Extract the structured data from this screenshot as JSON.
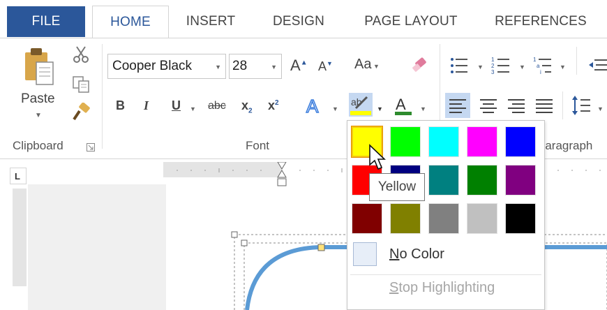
{
  "tabs": {
    "file": "FILE",
    "home": "HOME",
    "insert": "INSERT",
    "design": "DESIGN",
    "page_layout": "PAGE LAYOUT",
    "references": "REFERENCES"
  },
  "clipboard": {
    "paste_label": "Paste",
    "group_label": "Clipboard"
  },
  "font": {
    "font_name": "Cooper Black",
    "font_size": "28",
    "group_label": "Font",
    "change_case": "Aa",
    "bold": "B",
    "italic": "I",
    "underline": "U",
    "strikethrough": "abc",
    "subscript": "x",
    "superscript": "x"
  },
  "paragraph": {
    "group_label": "Paragraph"
  },
  "highlight_palette": {
    "swatches": [
      {
        "name": "Yellow",
        "color": "#ffff00"
      },
      {
        "name": "Bright Green",
        "color": "#00ff00"
      },
      {
        "name": "Turquoise",
        "color": "#00ffff"
      },
      {
        "name": "Pink",
        "color": "#ff00ff"
      },
      {
        "name": "Blue",
        "color": "#0000ff"
      },
      {
        "name": "Red",
        "color": "#ff0000"
      },
      {
        "name": "Dark Blue",
        "color": "#000080"
      },
      {
        "name": "Teal",
        "color": "#008080"
      },
      {
        "name": "Green",
        "color": "#008000"
      },
      {
        "name": "Violet",
        "color": "#800080"
      },
      {
        "name": "Dark Red",
        "color": "#800000"
      },
      {
        "name": "Dark Yellow",
        "color": "#808000"
      },
      {
        "name": "Gray 50%",
        "color": "#808080"
      },
      {
        "name": "Gray 25%",
        "color": "#c0c0c0"
      },
      {
        "name": "Black",
        "color": "#000000"
      }
    ],
    "no_color_underlined": "N",
    "no_color_rest": "o Color",
    "stop_underlined": "S",
    "stop_rest": "top Highlighting",
    "tooltip": "Yellow"
  },
  "colors": {
    "accent": "#2b579a",
    "shape_outline": "#5b9bd5"
  }
}
